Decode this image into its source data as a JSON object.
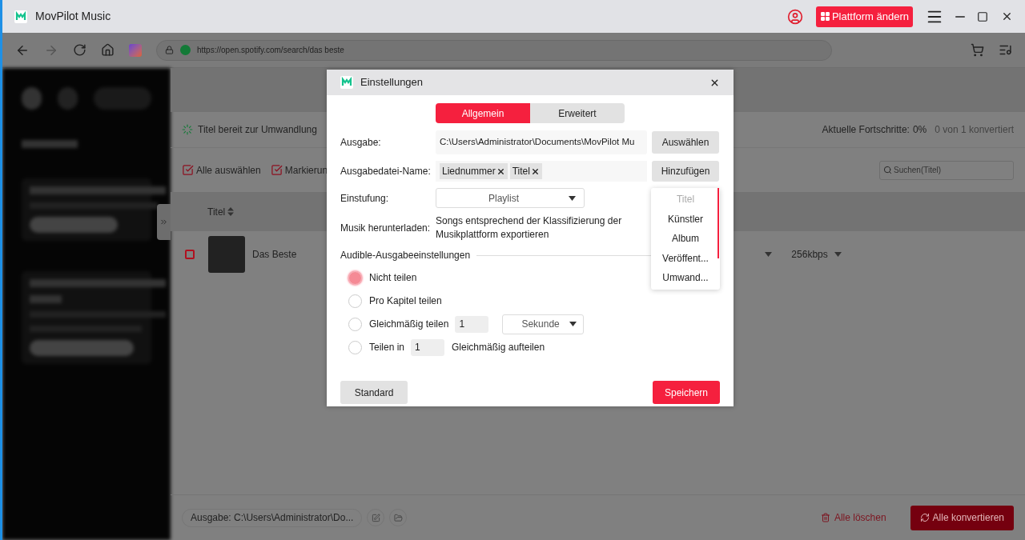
{
  "titlebar": {
    "app_title": "MovPilot Music",
    "platform_button": "Plattform ändern"
  },
  "browser": {
    "url": "https://open.spotify.com/search/das beste"
  },
  "converter": {
    "status": "Titel bereit zur Umwandlung",
    "progress_label": "Aktuelle Fortschritte:",
    "progress_value": "0%",
    "converted": "0 von 1 konvertiert",
    "select_all": "Alle auswählen",
    "mark": "Markierun",
    "search_placeholder": "Suchen(Titel)",
    "column": "Titel",
    "rows": [
      {
        "title": "Das Beste",
        "checked": false,
        "bitrate": "256kbps"
      }
    ],
    "output": "Ausgabe: C:\\Users\\Administrator\\Do...",
    "delete_all": "Alle löschen",
    "convert_all": "Alle konvertieren"
  },
  "dialog": {
    "title": "Einstellungen",
    "tabs": [
      {
        "label": "Allgemein",
        "selected": true
      },
      {
        "label": "Erweitert",
        "selected": false
      }
    ],
    "output_label": "Ausgabe:",
    "output_value": "C:\\Users\\Administrator\\Documents\\MovPilot Mu",
    "choose_button": "Auswählen",
    "filename_label": "Ausgabedatei-Name:",
    "tags": [
      "Liednummer",
      "Titel"
    ],
    "add_button": "Hinzufügen",
    "tag_menu": [
      {
        "label": "Titel",
        "disabled": true
      },
      {
        "label": "Künstler",
        "disabled": false
      },
      {
        "label": "Album",
        "disabled": false
      },
      {
        "label": "Veröffent...",
        "disabled": false
      },
      {
        "label": "Umwand...",
        "disabled": false
      }
    ],
    "rating_label": "Einstufung:",
    "rating_value": "Playlist",
    "download_label": "Musik herunterladen:",
    "download_text": "Songs entsprechend der Klassifizierung der Musikplattform exportieren",
    "section": "Audible-Ausgabeeinstellungen",
    "split_options": [
      {
        "kind": "plain",
        "label": "Nicht teilen",
        "selected": true
      },
      {
        "kind": "plain",
        "label": "Pro Kapitel teilen",
        "selected": false
      },
      {
        "kind": "interval",
        "label": "Gleichmäßig teilen",
        "selected": false,
        "value": "1",
        "unit": "Sekunde"
      },
      {
        "kind": "count",
        "label": "Teilen in",
        "selected": false,
        "value": "1",
        "suffix": "Gleichmäßig aufteilen"
      }
    ],
    "standard_button": "Standard",
    "save_button": "Speichern"
  }
}
